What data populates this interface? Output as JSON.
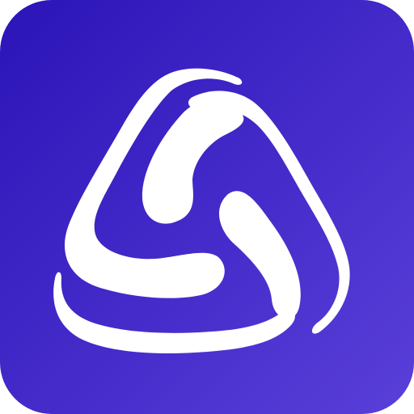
{
  "icon": {
    "name": "app-icon",
    "glyph": "triangular-swirl-logo-icon",
    "colors": {
      "gradient_start": "#2B14B8",
      "gradient_end": "#5A3FD9",
      "glyph": "#FFFFFF"
    }
  }
}
